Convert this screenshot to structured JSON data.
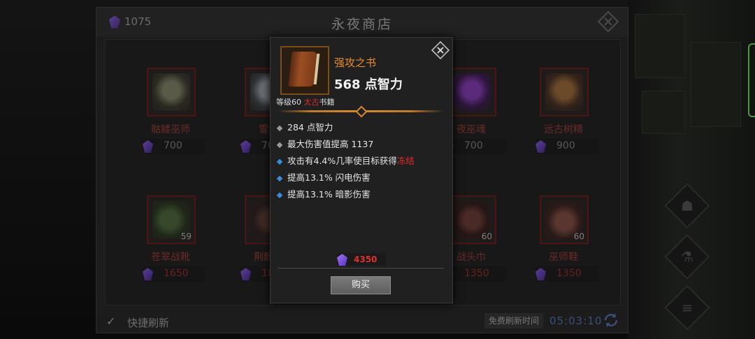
{
  "shop": {
    "currency": "1075",
    "title": "永夜商店",
    "items": [
      {
        "name": "骷髅巫师",
        "price": "700",
        "count": ""
      },
      {
        "name": "雪兔",
        "price": "700",
        "count": ""
      },
      {
        "name": "夜巫魂",
        "price": "700",
        "count": ""
      },
      {
        "name": "远古树精",
        "price": "900",
        "count": ""
      },
      {
        "name": "苍翠战靴",
        "price": "1650",
        "count": "59"
      },
      {
        "name": "荆棘之",
        "price": "1850",
        "count": ""
      },
      {
        "name": "战头巾",
        "price": "1350",
        "count": "60"
      },
      {
        "name": "巫师鞋",
        "price": "1350",
        "count": "60"
      }
    ],
    "footer": {
      "check": "✓",
      "quick_refresh": "快捷刷新",
      "free_refresh": "免费刷新时间",
      "timer": "05:03:10"
    }
  },
  "popup": {
    "name": "强攻之书",
    "main_stat": "568 点智力",
    "level_prefix": "等级60 ",
    "tier": "太古",
    "type": "书籍",
    "stats": {
      "s1": "284 点智力",
      "s2": "最大伤害值提高 1137",
      "s3_text": "攻击有4.4%几率使目标获得",
      "s3_highlight": "冻结",
      "s4": "提高13.1% 闪电伤害",
      "s5": "提高13.1% 暗影伤害"
    },
    "price": "4350",
    "buy_label": "购买"
  }
}
